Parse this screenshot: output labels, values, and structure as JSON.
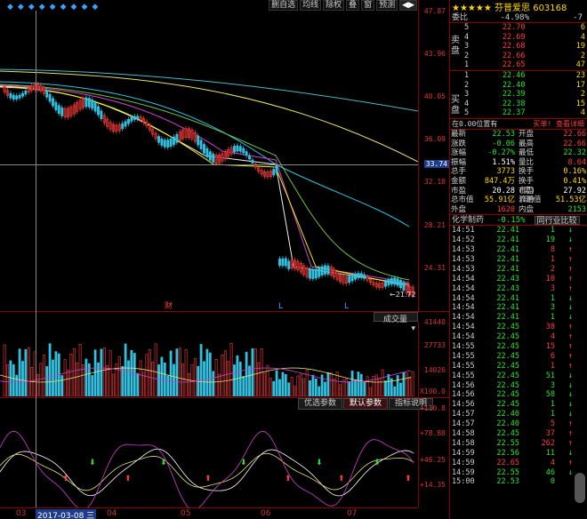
{
  "toolbar": {
    "stars": "◆◆◆◆◆◆◆◆◆",
    "buttons": [
      "删自选",
      "均线",
      "除权",
      "叠",
      "窗",
      "预测"
    ],
    "nav": "◀▶"
  },
  "price_axis": [
    "47.87",
    "43.96",
    "40.05",
    "36.09",
    "33.74",
    "32.18",
    "28.21",
    "24.31",
    "21.72"
  ],
  "highlight_price": "33.74",
  "low_annotation": "←21.72",
  "volume": {
    "indicator_label": "成交量",
    "axis": [
      "41440",
      "27733",
      "14026",
      "X100.0"
    ]
  },
  "tabs": [
    "优选参数",
    "默认参数",
    "指标说明"
  ],
  "indicator_axis": [
    "+110.8",
    "+78.88",
    "+46.25",
    "+14.35"
  ],
  "dates": {
    "highlight": "2017-03-08 三",
    "labels": [
      "03",
      "04",
      "05",
      "06",
      "07"
    ]
  },
  "events": [
    "财",
    "L",
    "L"
  ],
  "stock": {
    "name": "芬普爱思",
    "code": "603168",
    "rating": "★★★★★"
  },
  "order_book": {
    "wei_label": "委比",
    "wei_value": "-4.98%",
    "wei_diff": "-7",
    "sell_label": "卖盘",
    "buy_label": "买盘",
    "sells": [
      {
        "level": "5",
        "price": "22.70",
        "vol": "6"
      },
      {
        "level": "4",
        "price": "22.69",
        "vol": "4"
      },
      {
        "level": "3",
        "price": "22.68",
        "vol": "19"
      },
      {
        "level": "2",
        "price": "22.66",
        "vol": "2"
      },
      {
        "level": "1",
        "price": "22.65",
        "vol": "47"
      }
    ],
    "buys": [
      {
        "level": "1",
        "price": "22.46",
        "vol": "23"
      },
      {
        "level": "2",
        "price": "22.40",
        "vol": "17"
      },
      {
        "level": "3",
        "price": "22.39",
        "vol": "2"
      },
      {
        "level": "4",
        "price": "22.38",
        "vol": "15"
      },
      {
        "level": "5",
        "price": "22.37",
        "vol": "4"
      }
    ],
    "position_text": "在0.00位置有",
    "buy_detail": "买单! 查看详细"
  },
  "stats": [
    {
      "k1": "最新",
      "v1": "22.53",
      "c1": "green",
      "k2": "开盘",
      "v2": "22.66",
      "c2": "red"
    },
    {
      "k1": "涨跌",
      "v1": "-0.06",
      "c1": "green",
      "k2": "最高",
      "v2": "22.66",
      "c2": "red"
    },
    {
      "k1": "涨幅",
      "v1": "-0.27%",
      "c1": "green",
      "k2": "最低",
      "v2": "22.32",
      "c2": "green"
    },
    {
      "k1": "振幅",
      "v1": "1.51%",
      "c1": "white",
      "k2": "量比",
      "v2": "8.64",
      "c2": "red"
    },
    {
      "k1": "总手",
      "v1": "3773",
      "c1": "yellow",
      "k2": "换手",
      "v2": "0.16%",
      "c2": "yellow"
    },
    {
      "k1": "金额",
      "v1": "847.4万",
      "c1": "yellow",
      "k2": "换手(实)",
      "v2": "0.41%",
      "c2": "yellow"
    },
    {
      "k1": "市盈",
      "v1": "20.28",
      "c1": "white",
      "k2": "市盈(动)",
      "v2": "27.92",
      "c2": "white"
    },
    {
      "k1": "总市值",
      "v1": "55.91亿",
      "c1": "yellow",
      "k2": "流通值",
      "v2": "51.53亿",
      "c2": "yellow"
    },
    {
      "k1": "外盘",
      "v1": "1620",
      "c1": "red",
      "k2": "内盘",
      "v2": "2153",
      "c2": "green"
    }
  ],
  "sector": {
    "name": "化学制药",
    "change": "-0.15%",
    "button": "同行业比较"
  },
  "trades": [
    {
      "t": "14:51",
      "p": "22.41",
      "v": "1",
      "a": "↓"
    },
    {
      "t": "14:52",
      "p": "22.41",
      "v": "19",
      "a": "↓"
    },
    {
      "t": "14:53",
      "p": "22.41",
      "v": "8",
      "a": "↑"
    },
    {
      "t": "14:53",
      "p": "22.41",
      "v": "1",
      "a": "↑"
    },
    {
      "t": "14:53",
      "p": "22.41",
      "v": "2",
      "a": "↑"
    },
    {
      "t": "14:54",
      "p": "22.43",
      "v": "10",
      "a": "↑"
    },
    {
      "t": "14:54",
      "p": "22.43",
      "v": "3",
      "a": "↑"
    },
    {
      "t": "14:54",
      "p": "22.41",
      "v": "1",
      "a": "↓"
    },
    {
      "t": "14:54",
      "p": "22.41",
      "v": "3",
      "a": "↓"
    },
    {
      "t": "14:54",
      "p": "22.41",
      "v": "1",
      "a": "↓"
    },
    {
      "t": "14:54",
      "p": "22.45",
      "v": "38",
      "a": "↑"
    },
    {
      "t": "14:54",
      "p": "22.45",
      "v": "4",
      "a": "↑"
    },
    {
      "t": "14:55",
      "p": "22.45",
      "v": "15",
      "a": "↑"
    },
    {
      "t": "14:55",
      "p": "22.45",
      "v": "6",
      "a": "↑"
    },
    {
      "t": "14:55",
      "p": "22.45",
      "v": "1",
      "a": "↑"
    },
    {
      "t": "14:55",
      "p": "22.45",
      "v": "51",
      "a": "↓"
    },
    {
      "t": "14:56",
      "p": "22.45",
      "v": "3",
      "a": "↓"
    },
    {
      "t": "14:56",
      "p": "22.45",
      "v": "58",
      "a": "↓"
    },
    {
      "t": "14:56",
      "p": "22.45",
      "v": "1",
      "a": "↓"
    },
    {
      "t": "14:57",
      "p": "22.40",
      "v": "1",
      "a": "↓"
    },
    {
      "t": "14:57",
      "p": "22.40",
      "v": "5",
      "a": "↑"
    },
    {
      "t": "14:58",
      "p": "22.45",
      "v": "37",
      "a": "↑"
    },
    {
      "t": "14:58",
      "p": "22.55",
      "v": "262",
      "a": "↑"
    },
    {
      "t": "14:59",
      "p": "22.56",
      "v": "11",
      "a": "↓"
    },
    {
      "t": "14:59",
      "p": "22.65",
      "v": "4",
      "a": "↑"
    },
    {
      "t": "14:59",
      "p": "22.55",
      "v": "46",
      "a": "↓"
    },
    {
      "t": "15:00",
      "p": "22.53",
      "v": "0",
      "a": ""
    }
  ],
  "colors": {
    "up": "#ff3c3c",
    "down": "#2ee02e",
    "axis_line": "#8b0000",
    "highlight_bg": "#1e3c8c"
  }
}
